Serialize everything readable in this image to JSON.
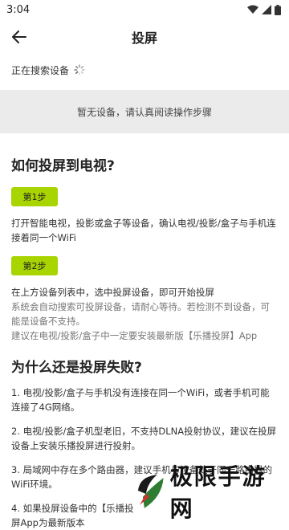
{
  "status": {
    "time": "3:04"
  },
  "appbar": {
    "title": "投屏"
  },
  "search": {
    "status_text": "正在搜索设备"
  },
  "empty": {
    "message": "暂无设备，请认真阅读操作步骤"
  },
  "howto": {
    "title": "如何投屏到电视?",
    "step1": {
      "badge": "第1步",
      "text": "打开智能电视，投影或盒子等设备，确认电视/投影/盒子与手机连接着同一个WiFi"
    },
    "step2": {
      "badge": "第2步",
      "text": "在上方设备列表中，选中投屏设备，即可开始投屏",
      "note": "系统会自动搜索可投屏设备，请耐心等待。若检测不到设备，可能是设备不支持。",
      "tip": "建议在电视/投影/盒子中一定要安装最新版【乐播投屏】App"
    }
  },
  "fail": {
    "title": "为什么还是投屏失败?",
    "items": [
      "1. 电视/投影/盒子与手机没有连接在同一个WiFi，或者手机可能连接了4G网络。",
      "2. 电视/投影/盒子机型老旧，不支持DLNA投射协议，建议在投屏设备上安装乐播投屏进行投射。",
      "3. 局域网中存在多个路由器，建议手机与设备处于同一路由器的WiFi环境。",
      "4. 如果投屏设备中的【乐播投",
      "屏App为最新版本"
    ]
  },
  "watermark": {
    "text": "极限手游网"
  },
  "colors": {
    "accent": "#a8d400",
    "empty_bg": "#ebebeb"
  }
}
